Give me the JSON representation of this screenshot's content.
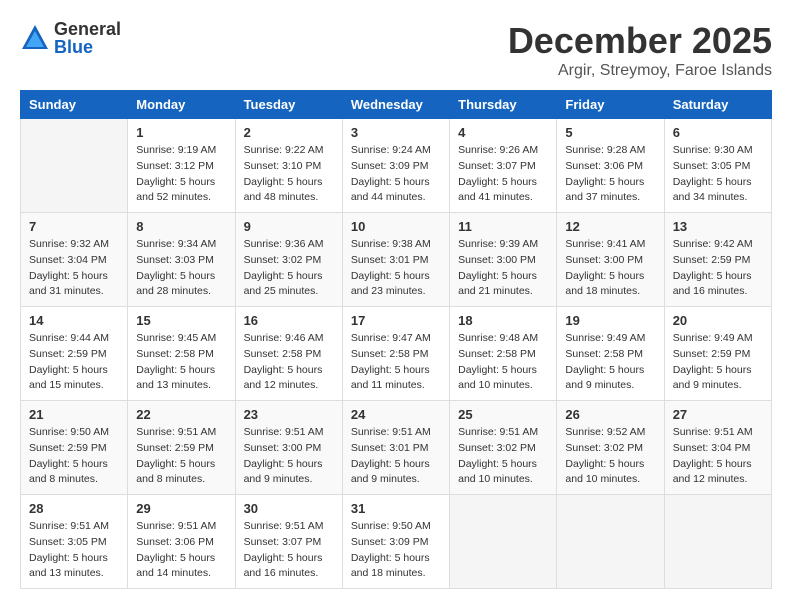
{
  "logo": {
    "general": "General",
    "blue": "Blue"
  },
  "header": {
    "month": "December 2025",
    "location": "Argir, Streymoy, Faroe Islands"
  },
  "weekdays": [
    "Sunday",
    "Monday",
    "Tuesday",
    "Wednesday",
    "Thursday",
    "Friday",
    "Saturday"
  ],
  "weeks": [
    [
      {
        "day": "",
        "info": ""
      },
      {
        "day": "1",
        "info": "Sunrise: 9:19 AM\nSunset: 3:12 PM\nDaylight: 5 hours\nand 52 minutes."
      },
      {
        "day": "2",
        "info": "Sunrise: 9:22 AM\nSunset: 3:10 PM\nDaylight: 5 hours\nand 48 minutes."
      },
      {
        "day": "3",
        "info": "Sunrise: 9:24 AM\nSunset: 3:09 PM\nDaylight: 5 hours\nand 44 minutes."
      },
      {
        "day": "4",
        "info": "Sunrise: 9:26 AM\nSunset: 3:07 PM\nDaylight: 5 hours\nand 41 minutes."
      },
      {
        "day": "5",
        "info": "Sunrise: 9:28 AM\nSunset: 3:06 PM\nDaylight: 5 hours\nand 37 minutes."
      },
      {
        "day": "6",
        "info": "Sunrise: 9:30 AM\nSunset: 3:05 PM\nDaylight: 5 hours\nand 34 minutes."
      }
    ],
    [
      {
        "day": "7",
        "info": "Sunrise: 9:32 AM\nSunset: 3:04 PM\nDaylight: 5 hours\nand 31 minutes."
      },
      {
        "day": "8",
        "info": "Sunrise: 9:34 AM\nSunset: 3:03 PM\nDaylight: 5 hours\nand 28 minutes."
      },
      {
        "day": "9",
        "info": "Sunrise: 9:36 AM\nSunset: 3:02 PM\nDaylight: 5 hours\nand 25 minutes."
      },
      {
        "day": "10",
        "info": "Sunrise: 9:38 AM\nSunset: 3:01 PM\nDaylight: 5 hours\nand 23 minutes."
      },
      {
        "day": "11",
        "info": "Sunrise: 9:39 AM\nSunset: 3:00 PM\nDaylight: 5 hours\nand 21 minutes."
      },
      {
        "day": "12",
        "info": "Sunrise: 9:41 AM\nSunset: 3:00 PM\nDaylight: 5 hours\nand 18 minutes."
      },
      {
        "day": "13",
        "info": "Sunrise: 9:42 AM\nSunset: 2:59 PM\nDaylight: 5 hours\nand 16 minutes."
      }
    ],
    [
      {
        "day": "14",
        "info": "Sunrise: 9:44 AM\nSunset: 2:59 PM\nDaylight: 5 hours\nand 15 minutes."
      },
      {
        "day": "15",
        "info": "Sunrise: 9:45 AM\nSunset: 2:58 PM\nDaylight: 5 hours\nand 13 minutes."
      },
      {
        "day": "16",
        "info": "Sunrise: 9:46 AM\nSunset: 2:58 PM\nDaylight: 5 hours\nand 12 minutes."
      },
      {
        "day": "17",
        "info": "Sunrise: 9:47 AM\nSunset: 2:58 PM\nDaylight: 5 hours\nand 11 minutes."
      },
      {
        "day": "18",
        "info": "Sunrise: 9:48 AM\nSunset: 2:58 PM\nDaylight: 5 hours\nand 10 minutes."
      },
      {
        "day": "19",
        "info": "Sunrise: 9:49 AM\nSunset: 2:58 PM\nDaylight: 5 hours\nand 9 minutes."
      },
      {
        "day": "20",
        "info": "Sunrise: 9:49 AM\nSunset: 2:59 PM\nDaylight: 5 hours\nand 9 minutes."
      }
    ],
    [
      {
        "day": "21",
        "info": "Sunrise: 9:50 AM\nSunset: 2:59 PM\nDaylight: 5 hours\nand 8 minutes."
      },
      {
        "day": "22",
        "info": "Sunrise: 9:51 AM\nSunset: 2:59 PM\nDaylight: 5 hours\nand 8 minutes."
      },
      {
        "day": "23",
        "info": "Sunrise: 9:51 AM\nSunset: 3:00 PM\nDaylight: 5 hours\nand 9 minutes."
      },
      {
        "day": "24",
        "info": "Sunrise: 9:51 AM\nSunset: 3:01 PM\nDaylight: 5 hours\nand 9 minutes."
      },
      {
        "day": "25",
        "info": "Sunrise: 9:51 AM\nSunset: 3:02 PM\nDaylight: 5 hours\nand 10 minutes."
      },
      {
        "day": "26",
        "info": "Sunrise: 9:52 AM\nSunset: 3:02 PM\nDaylight: 5 hours\nand 10 minutes."
      },
      {
        "day": "27",
        "info": "Sunrise: 9:51 AM\nSunset: 3:04 PM\nDaylight: 5 hours\nand 12 minutes."
      }
    ],
    [
      {
        "day": "28",
        "info": "Sunrise: 9:51 AM\nSunset: 3:05 PM\nDaylight: 5 hours\nand 13 minutes."
      },
      {
        "day": "29",
        "info": "Sunrise: 9:51 AM\nSunset: 3:06 PM\nDaylight: 5 hours\nand 14 minutes."
      },
      {
        "day": "30",
        "info": "Sunrise: 9:51 AM\nSunset: 3:07 PM\nDaylight: 5 hours\nand 16 minutes."
      },
      {
        "day": "31",
        "info": "Sunrise: 9:50 AM\nSunset: 3:09 PM\nDaylight: 5 hours\nand 18 minutes."
      },
      {
        "day": "",
        "info": ""
      },
      {
        "day": "",
        "info": ""
      },
      {
        "day": "",
        "info": ""
      }
    ]
  ]
}
